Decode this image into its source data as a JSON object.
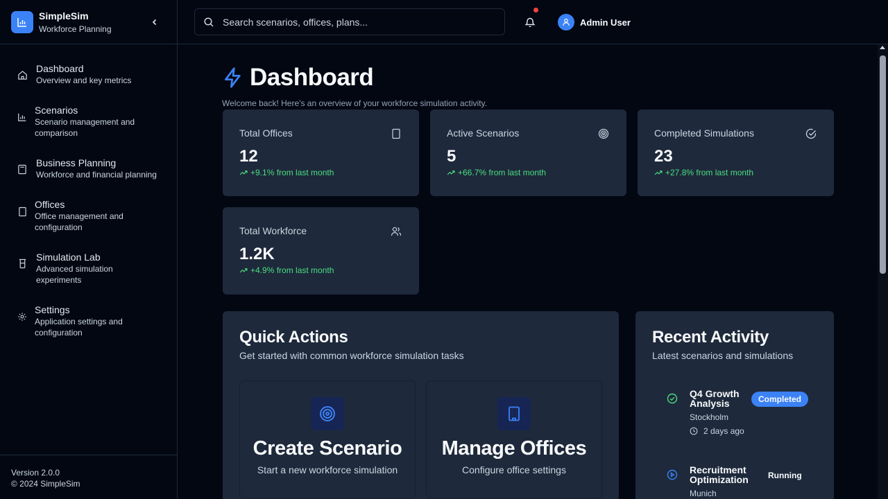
{
  "brand": {
    "name": "SimpleSim",
    "subtitle": "Workforce Planning"
  },
  "nav": [
    {
      "label": "Dashboard",
      "desc": "Overview and key metrics",
      "icon": "home-icon"
    },
    {
      "label": "Scenarios",
      "desc": "Scenario management and comparison",
      "icon": "bar-chart-icon"
    },
    {
      "label": "Business Planning",
      "desc": "Workforce and financial planning",
      "icon": "calculator-icon"
    },
    {
      "label": "Offices",
      "desc": "Office management and configuration",
      "icon": "building-icon"
    },
    {
      "label": "Simulation Lab",
      "desc": "Advanced simulation experiments",
      "icon": "beaker-icon"
    },
    {
      "label": "Settings",
      "desc": "Application settings and configuration",
      "icon": "gear-icon"
    }
  ],
  "footer": {
    "version": "Version 2.0.0",
    "copyright": "© 2024 SimpleSim"
  },
  "search": {
    "placeholder": "Search scenarios, offices, plans..."
  },
  "user": {
    "name": "Admin User"
  },
  "page": {
    "title": "Dashboard",
    "subtitle": "Welcome back! Here's an overview of your workforce simulation activity."
  },
  "stats": [
    {
      "label": "Total Offices",
      "value": "12",
      "trend": "+9.1% from last month",
      "icon": "building-icon"
    },
    {
      "label": "Active Scenarios",
      "value": "5",
      "trend": "+66.7% from last month",
      "icon": "target-icon"
    },
    {
      "label": "Completed Simulations",
      "value": "23",
      "trend": "+27.8% from last month",
      "icon": "check-circle-icon"
    },
    {
      "label": "Total Workforce",
      "value": "1.2K",
      "trend": "+4.9% from last month",
      "icon": "users-icon"
    }
  ],
  "quick_actions": {
    "title": "Quick Actions",
    "subtitle": "Get started with common workforce simulation tasks",
    "items": [
      {
        "title": "Create Scenario",
        "desc": "Start a new workforce simulation",
        "icon": "target-icon"
      },
      {
        "title": "Manage Offices",
        "desc": "Configure office settings",
        "icon": "building-icon"
      }
    ]
  },
  "recent_activity": {
    "title": "Recent Activity",
    "subtitle": "Latest scenarios and simulations",
    "items": [
      {
        "title": "Q4 Growth Analysis",
        "location": "Stockholm",
        "time": "2 days ago",
        "status": "Completed",
        "icon": "check-circle-icon"
      },
      {
        "title": "Recruitment Optimization",
        "location": "Munich",
        "status": "Running",
        "icon": "play-circle-icon"
      }
    ]
  },
  "colors": {
    "accent": "#3b82f6",
    "positive": "#4ade80",
    "card": "#1e293b",
    "background": "#030712",
    "alert": "#ef4444"
  }
}
